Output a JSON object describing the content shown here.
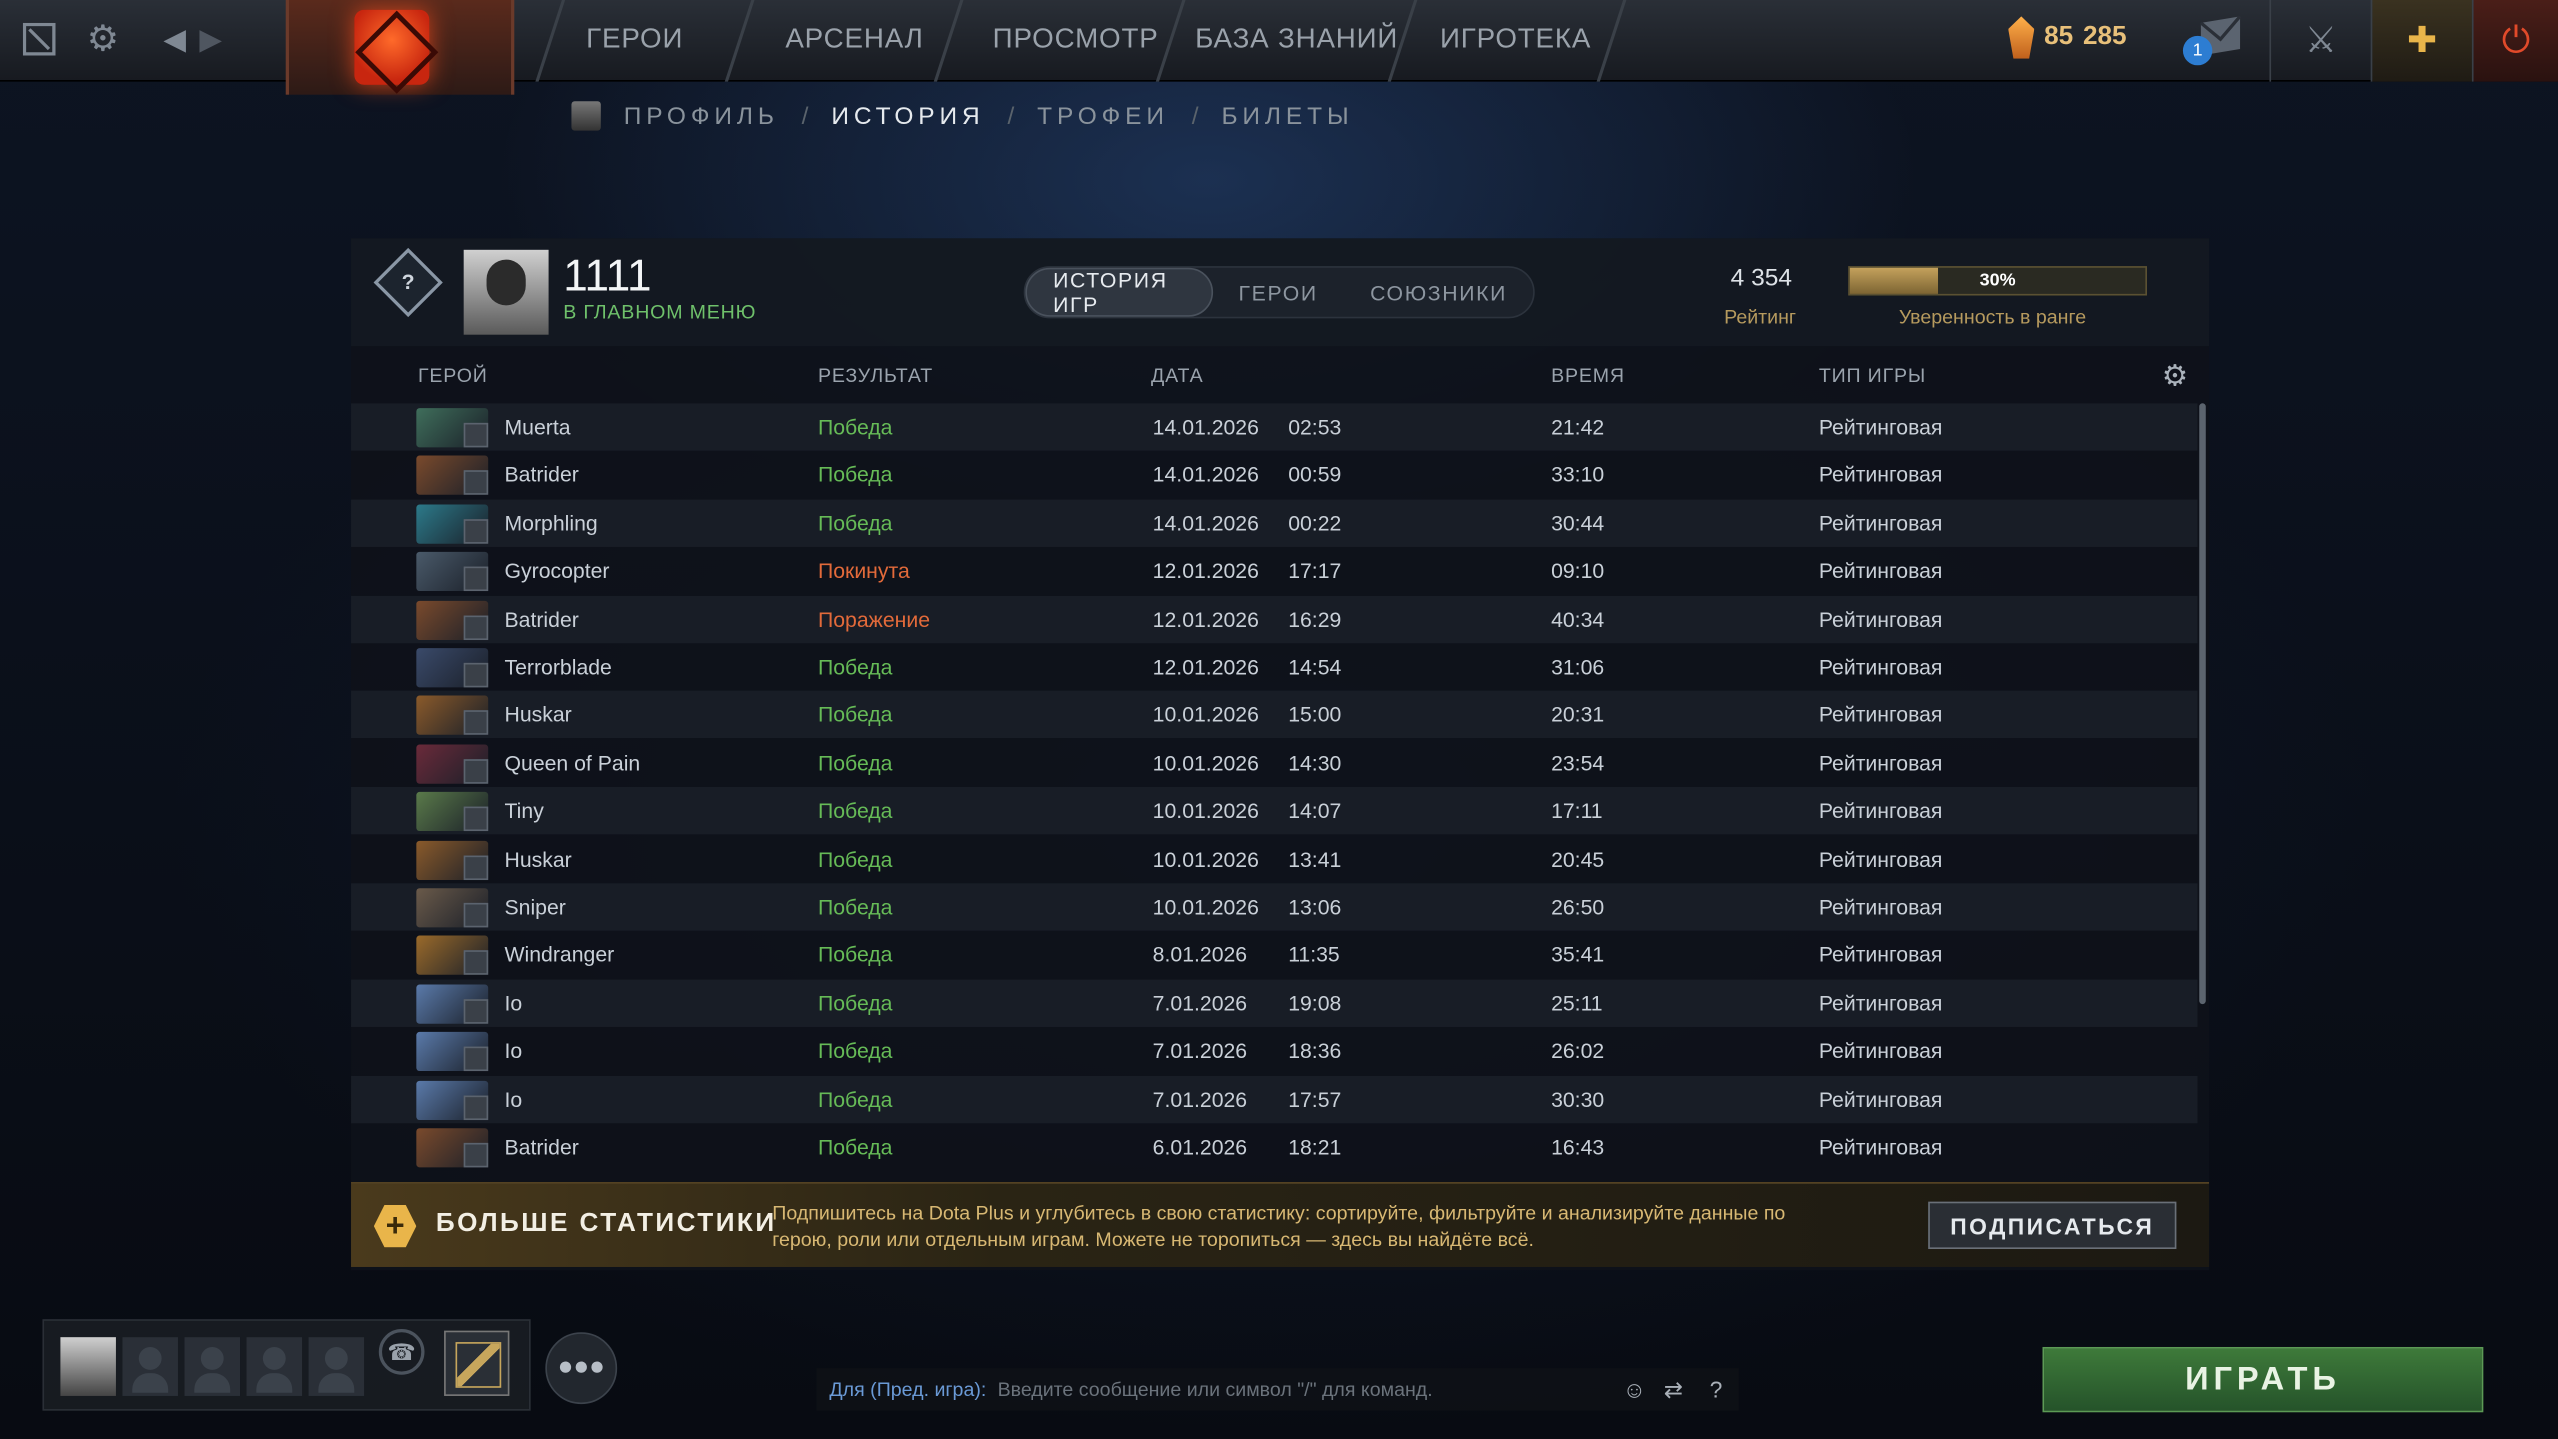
{
  "topnav": {
    "items": [
      "ГЕРОИ",
      "АРСЕНАЛ",
      "ПРОСМОТР",
      "БАЗА ЗНАНИЙ",
      "ИГРОТЕКА"
    ],
    "shards_a": "85",
    "shards_b": "285",
    "mail_badge": "1"
  },
  "subnav": {
    "profile": "ПРОФИЛЬ",
    "history": "ИСТОРИЯ",
    "trophies": "ТРОФЕИ",
    "tickets": "БИЛЕТЫ",
    "sep": "/"
  },
  "player": {
    "rank_glyph": "?",
    "name": "1111",
    "status": "В ГЛАВНОМ МЕНЮ"
  },
  "tabs": [
    "ИСТОРИЯ ИГР",
    "ГЕРОИ",
    "СОЮЗНИКИ"
  ],
  "rating": {
    "value": "4 354",
    "label": "Рейтинг",
    "confidence_value": 0.3,
    "confidence_text": "30%",
    "confidence_label": "Уверенность в ранге"
  },
  "table": {
    "columns": [
      "ГЕРОЙ",
      "РЕЗУЛЬТАТ",
      "ДАТА",
      "ВРЕМЯ",
      "ТИП ИГРЫ"
    ],
    "rows": [
      {
        "hero": "Muerta",
        "result": "Победа",
        "result_type": "win",
        "date": "14.01.2026",
        "time": "02:53",
        "duration": "21:42",
        "type": "Рейтинговая",
        "color": "#3f6e5b"
      },
      {
        "hero": "Batrider",
        "result": "Победа",
        "result_type": "win",
        "date": "14.01.2026",
        "time": "00:59",
        "duration": "33:10",
        "type": "Рейтинговая",
        "color": "#7a4a2c"
      },
      {
        "hero": "Morphling",
        "result": "Победа",
        "result_type": "win",
        "date": "14.01.2026",
        "time": "00:22",
        "duration": "30:44",
        "type": "Рейтинговая",
        "color": "#2c7a8a"
      },
      {
        "hero": "Gyrocopter",
        "result": "Покинута",
        "result_type": "loss",
        "date": "12.01.2026",
        "time": "17:17",
        "duration": "09:10",
        "type": "Рейтинговая",
        "color": "#4a5a6a"
      },
      {
        "hero": "Batrider",
        "result": "Поражение",
        "result_type": "loss",
        "date": "12.01.2026",
        "time": "16:29",
        "duration": "40:34",
        "type": "Рейтинговая",
        "color": "#7a4a2c"
      },
      {
        "hero": "Terrorblade",
        "result": "Победа",
        "result_type": "win",
        "date": "12.01.2026",
        "time": "14:54",
        "duration": "31:06",
        "type": "Рейтинговая",
        "color": "#3a4a6a"
      },
      {
        "hero": "Huskar",
        "result": "Победа",
        "result_type": "win",
        "date": "10.01.2026",
        "time": "15:00",
        "duration": "20:31",
        "type": "Рейтинговая",
        "color": "#8a5a2a"
      },
      {
        "hero": "Queen of Pain",
        "result": "Победа",
        "result_type": "win",
        "date": "10.01.2026",
        "time": "14:30",
        "duration": "23:54",
        "type": "Рейтинговая",
        "color": "#6a2a3a"
      },
      {
        "hero": "Tiny",
        "result": "Победа",
        "result_type": "win",
        "date": "10.01.2026",
        "time": "14:07",
        "duration": "17:11",
        "type": "Рейтинговая",
        "color": "#5a7a4a"
      },
      {
        "hero": "Huskar",
        "result": "Победа",
        "result_type": "win",
        "date": "10.01.2026",
        "time": "13:41",
        "duration": "20:45",
        "type": "Рейтинговая",
        "color": "#8a5a2a"
      },
      {
        "hero": "Sniper",
        "result": "Победа",
        "result_type": "win",
        "date": "10.01.2026",
        "time": "13:06",
        "duration": "26:50",
        "type": "Рейтинговая",
        "color": "#6a5a4a"
      },
      {
        "hero": "Windranger",
        "result": "Победа",
        "result_type": "win",
        "date": "8.01.2026",
        "time": "11:35",
        "duration": "35:41",
        "type": "Рейтинговая",
        "color": "#9a6a2a"
      },
      {
        "hero": "Io",
        "result": "Победа",
        "result_type": "win",
        "date": "7.01.2026",
        "time": "19:08",
        "duration": "25:11",
        "type": "Рейтинговая",
        "color": "#5a7aaa"
      },
      {
        "hero": "Io",
        "result": "Победа",
        "result_type": "win",
        "date": "7.01.2026",
        "time": "18:36",
        "duration": "26:02",
        "type": "Рейтинговая",
        "color": "#5a7aaa"
      },
      {
        "hero": "Io",
        "result": "Победа",
        "result_type": "win",
        "date": "7.01.2026",
        "time": "17:57",
        "duration": "30:30",
        "type": "Рейтинговая",
        "color": "#5a7aaa"
      },
      {
        "hero": "Batrider",
        "result": "Победа",
        "result_type": "win",
        "date": "6.01.2026",
        "time": "18:21",
        "duration": "16:43",
        "type": "Рейтинговая",
        "color": "#7a4a2c"
      }
    ]
  },
  "dota_plus": {
    "title": "БОЛЬШЕ СТАТИСТИКИ",
    "description": "Подпишитесь на Dota Plus и углубитесь в свою статистику: сортируйте, фильтруйте и анализируйте данные по герою, роли или отдельным играм. Можете не торопиться — здесь вы найдёте всё.",
    "button": "ПОДПИСАТЬСЯ"
  },
  "chat": {
    "channel": "Для (Пред. игра):",
    "placeholder": "Введите сообщение или символ \"/\" для команд.",
    "help": "?"
  },
  "play_button": "ИГРАТЬ",
  "colors": {
    "win": "#66bb57",
    "loss": "#e26a3a",
    "play": "#3e7a3a",
    "accent_gold": "#b69a5e"
  },
  "icons": {
    "dota_logo": "dota-logo-icon",
    "settings": "gear-icon",
    "back": "chevron-left-icon",
    "forward": "chevron-right-icon",
    "shards": "shard-icon",
    "mail": "mail-icon",
    "armory": "armory-icon",
    "plus": "dota-plus-icon",
    "power": "power-icon",
    "headset": "headset-icon",
    "friends": "friends-icon",
    "emoji": "emoji-icon",
    "translate": "translate-icon"
  }
}
